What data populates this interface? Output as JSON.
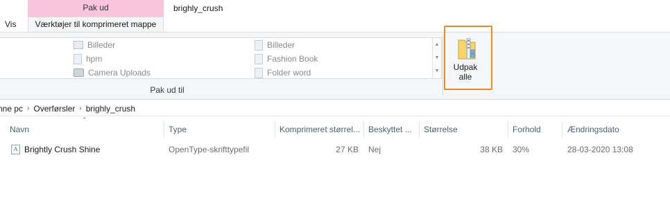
{
  "window": {
    "context_tab_header": "Pak ud",
    "title": "brighly_crush"
  },
  "ribbon": {
    "tabs": [
      {
        "label": "Vis"
      },
      {
        "label": "Værktøjer til komprimeret mappe"
      }
    ],
    "gallery": {
      "items": [
        {
          "label": "Billeder",
          "icon": "pictures-folder-icon"
        },
        {
          "label": "hpm",
          "icon": "document-icon"
        },
        {
          "label": "Camera Uploads",
          "icon": "camera-folder-icon"
        },
        {
          "label": "Billeder",
          "icon": "document-icon"
        },
        {
          "label": "Fashion Book",
          "icon": "document-icon"
        },
        {
          "label": "Folder word",
          "icon": "document-icon"
        }
      ],
      "group_label": "Pak ud til"
    },
    "extract_all": {
      "label_line1": "Udpak",
      "label_line2": "alle",
      "icon": "zip-folder-icon"
    },
    "highlight_color": "#f08a1c"
  },
  "address_bar": {
    "crumbs": [
      "nne pc",
      "Overførsler",
      "brighly_crush"
    ]
  },
  "file_list": {
    "columns": [
      "Navn",
      "Type",
      "Komprimeret størrel...",
      "Beskyttet ...",
      "Størrelse",
      "Forhold",
      "Ændringsdato"
    ],
    "rows": [
      {
        "name": "Brightly Crush Shine",
        "type": "OpenType-skrifttypefil",
        "compressed_size": "27 KB",
        "protected": "Nej",
        "size": "38 KB",
        "ratio": "30%",
        "modified": "28-03-2020 13:08"
      }
    ]
  },
  "colors": {
    "context_tab": "#f9c5dd",
    "column_header_text": "#4c607a"
  }
}
